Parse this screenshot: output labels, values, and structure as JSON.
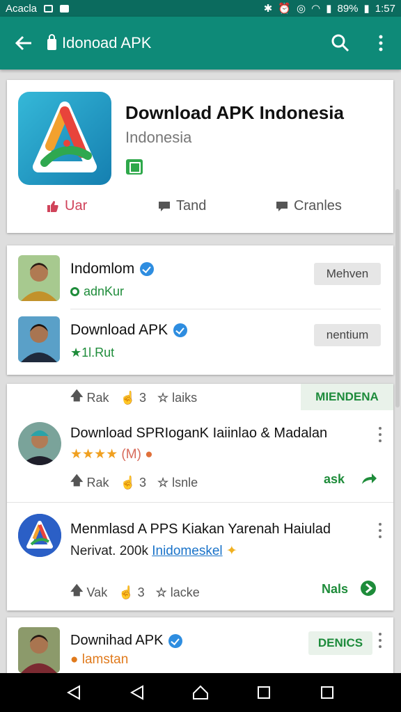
{
  "status_bar": {
    "left_text": "Acacla",
    "battery": "89%",
    "time": "1:57"
  },
  "app_bar": {
    "title": "Idonoad APK"
  },
  "hero": {
    "name": "Download APK Indonesia",
    "subtitle": "Indonesia",
    "actions": [
      {
        "label": "Uar",
        "color": "#d0435a"
      },
      {
        "label": "Tand",
        "color": "#555555"
      },
      {
        "label": "Cranles",
        "color": "#555555"
      }
    ]
  },
  "publishers": [
    {
      "name": "Indomlom",
      "sub": "adnKur",
      "button": "Mehven"
    },
    {
      "name": "Download APK",
      "sub": "★1l.Rut",
      "button": "nentium"
    }
  ],
  "posts_header": {
    "meta": [
      "Rak",
      "3",
      "laiks"
    ],
    "tag": "MIENDENA"
  },
  "posts": [
    {
      "title": "Download SPRIoganK Iaiinlao & Madalan",
      "rating_text": "(M)",
      "meta": [
        "Rak",
        "3",
        "lsnle"
      ],
      "action": "ask"
    },
    {
      "title": "Menmlasd A PPS Kiakan Yarenah Haiulad",
      "sub_prefix": "Nerivat. 200k",
      "sub_link": "Inidomeskel",
      "meta": [
        "Vak",
        "3",
        "lacke"
      ],
      "action": "Nals"
    }
  ],
  "partial_card": {
    "name": "Downihad APK",
    "sub": "lamstan",
    "tag": "DENICS"
  },
  "colors": {
    "primary": "#0e8a78",
    "primary_dark": "#0b6b5e",
    "green": "#1e8c3a",
    "accent_link": "#1a73c9"
  }
}
